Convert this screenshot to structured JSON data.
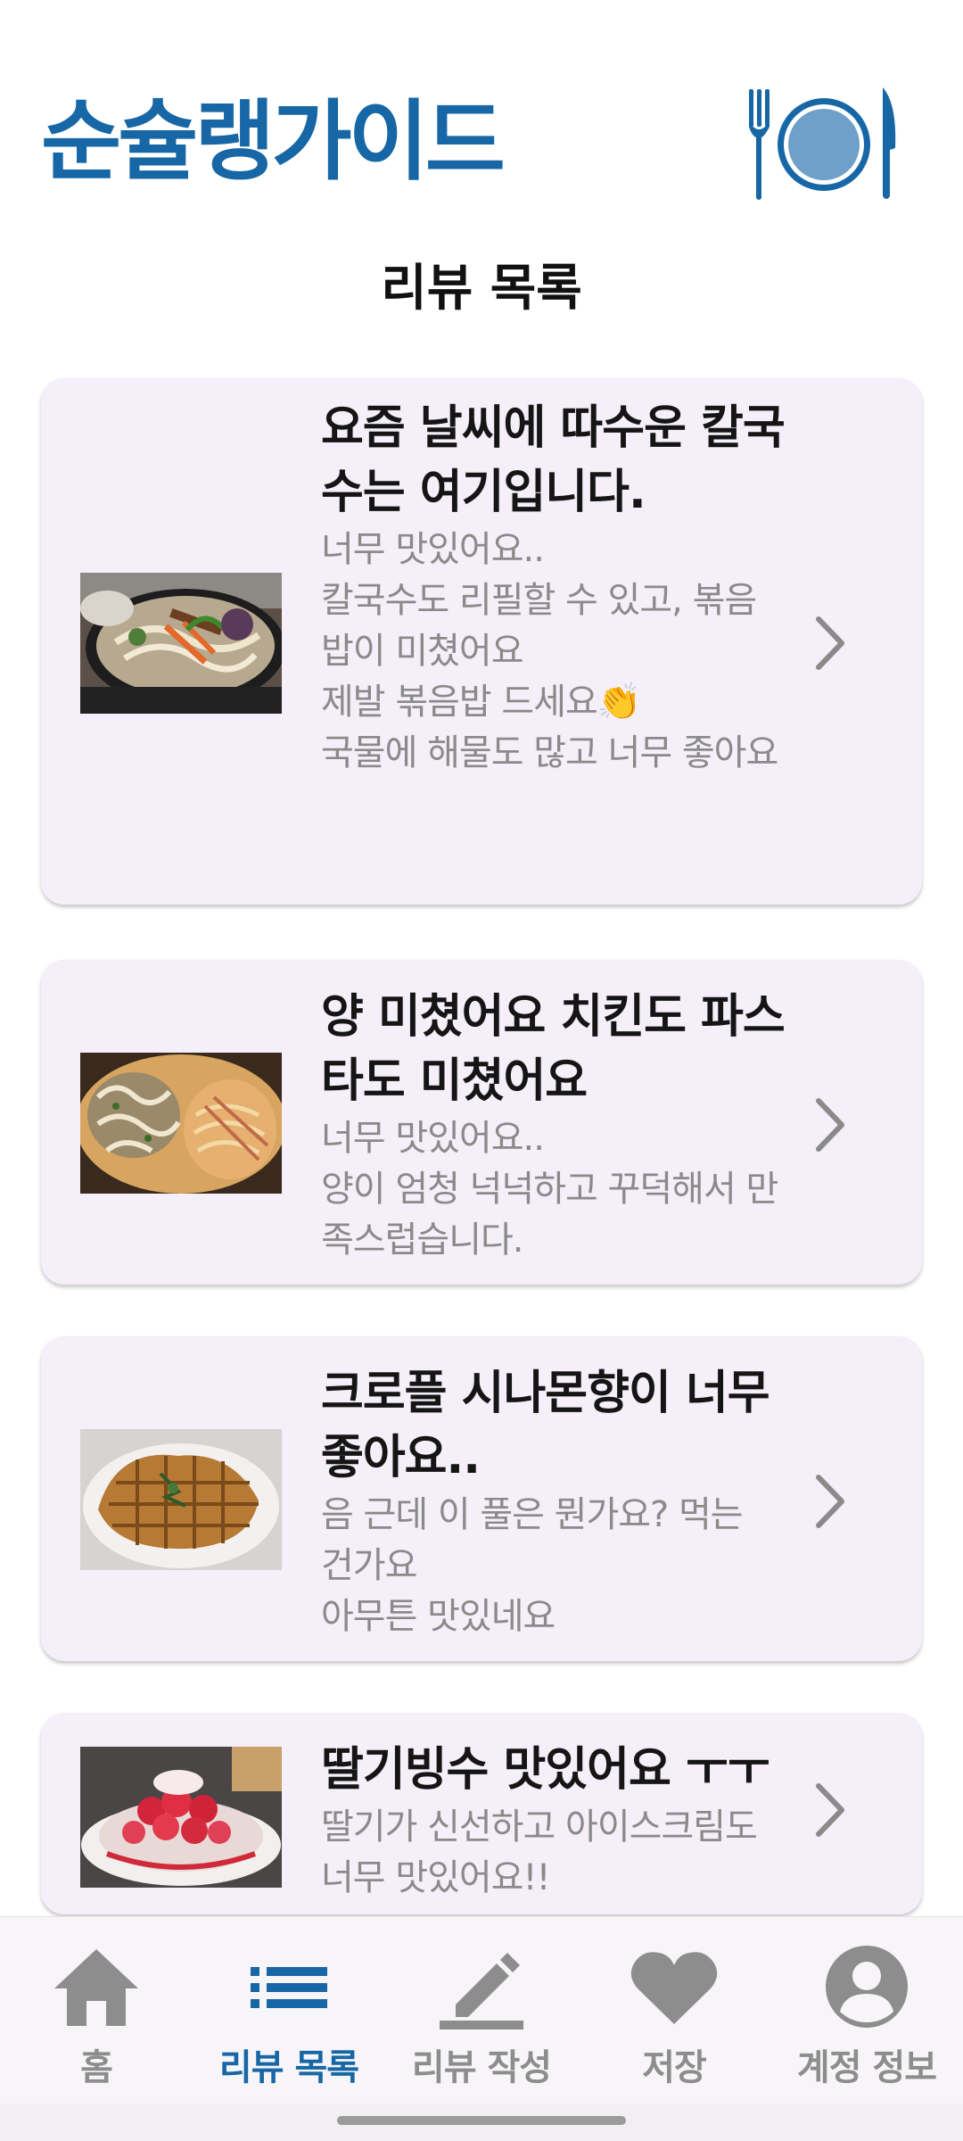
{
  "header": {
    "app_title": "순슐랭가이드",
    "logo_icon": "plate-fork-knife-icon"
  },
  "page_title": "리뷰 목록",
  "reviews": [
    {
      "title": "요즘 날씨에 따수운 칼국수는 여기입니다.",
      "body": "너무 맛있어요..\n칼국수도 리필할 수 있고, 볶음밥이 미쳤어요\n제발 볶음밥 드세요👏\n국물에 해물도 많고 너무 좋아요",
      "image": "kalguksu-photo"
    },
    {
      "title": "양 미쳤어요 치킨도 파스타도 미쳤어요",
      "body": "너무 맛있어요..\n양이 엄청 넉넉하고 꾸덕해서 만족스럽습니다.",
      "image": "chicken-pasta-photo"
    },
    {
      "title": "크로플 시나몬향이 너무 좋아요..",
      "body": "음 근데 이 풀은 뭔가요? 먹는 건가요\n아무튼 맛있네요",
      "image": "croffle-photo"
    },
    {
      "title": "딸기빙수 맛있어요 ㅜㅜ",
      "body": "딸기가 신선하고 아이스크림도 너무 맛있어요!!",
      "image": "strawberry-bingsu-photo"
    }
  ],
  "bottom_nav": [
    {
      "label": "홈",
      "icon": "home-icon",
      "active": false
    },
    {
      "label": "리뷰 목록",
      "icon": "list-icon",
      "active": true
    },
    {
      "label": "리뷰 작성",
      "icon": "pencil-icon",
      "active": false
    },
    {
      "label": "저장",
      "icon": "heart-icon",
      "active": false
    },
    {
      "label": "계정 정보",
      "icon": "account-icon",
      "active": false
    }
  ],
  "colors": {
    "brand": "#1767a6",
    "card_bg": "#f4eff8",
    "inactive": "#8d8d8d"
  }
}
